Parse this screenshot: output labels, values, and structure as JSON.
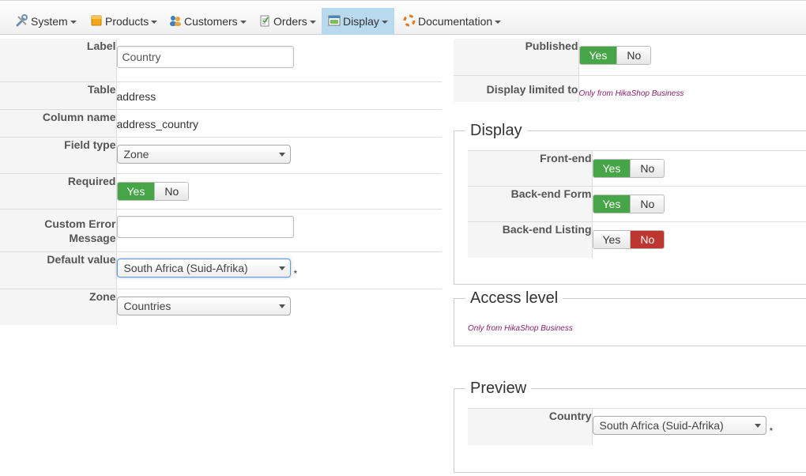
{
  "menu": [
    {
      "label": "System",
      "icon": "wrench-icon"
    },
    {
      "label": "Products",
      "icon": "box-icon"
    },
    {
      "label": "Customers",
      "icon": "users-icon"
    },
    {
      "label": "Orders",
      "icon": "clipboard-icon"
    },
    {
      "label": "Display",
      "icon": "window-icon",
      "active": true
    },
    {
      "label": "Documentation",
      "icon": "lifebuoy-icon"
    }
  ],
  "field": {
    "label_label": "Label",
    "label_value": "Country",
    "table_label": "Table",
    "table_value": "address",
    "column_label": "Column name",
    "column_value": "address_country",
    "type_label": "Field type",
    "type_value": "Zone",
    "required_label": "Required",
    "required_yes": "Yes",
    "required_no": "No",
    "required_value": "Yes",
    "custom_error_label": "Custom Error Message",
    "custom_error_value": "",
    "default_label": "Default value",
    "default_value": "South Africa (Suid-Afrika)",
    "default_star": "*",
    "zone_label": "Zone",
    "zone_value": "Countries"
  },
  "publish": {
    "published_label": "Published",
    "yes": "Yes",
    "no": "No",
    "published_value": "Yes",
    "limited_label": "Display limited to",
    "limited_note": "Only from HikaShop Business"
  },
  "display": {
    "legend": "Display",
    "frontend_label": "Front-end",
    "frontend_value": "Yes",
    "backform_label": "Back-end Form",
    "backform_value": "Yes",
    "backlist_label": "Back-end Listing",
    "backlist_value": "No",
    "yes": "Yes",
    "no": "No"
  },
  "access": {
    "legend": "Access level",
    "note": "Only from HikaShop Business"
  },
  "preview": {
    "legend": "Preview",
    "country_label": "Country",
    "country_value": "South Africa (Suid-Afrika)",
    "star": "*"
  },
  "colors": {
    "yes_active": "#46a546",
    "no_active": "#bd362f",
    "menu_active": "#b9d9ef",
    "note": "#8a2069"
  }
}
